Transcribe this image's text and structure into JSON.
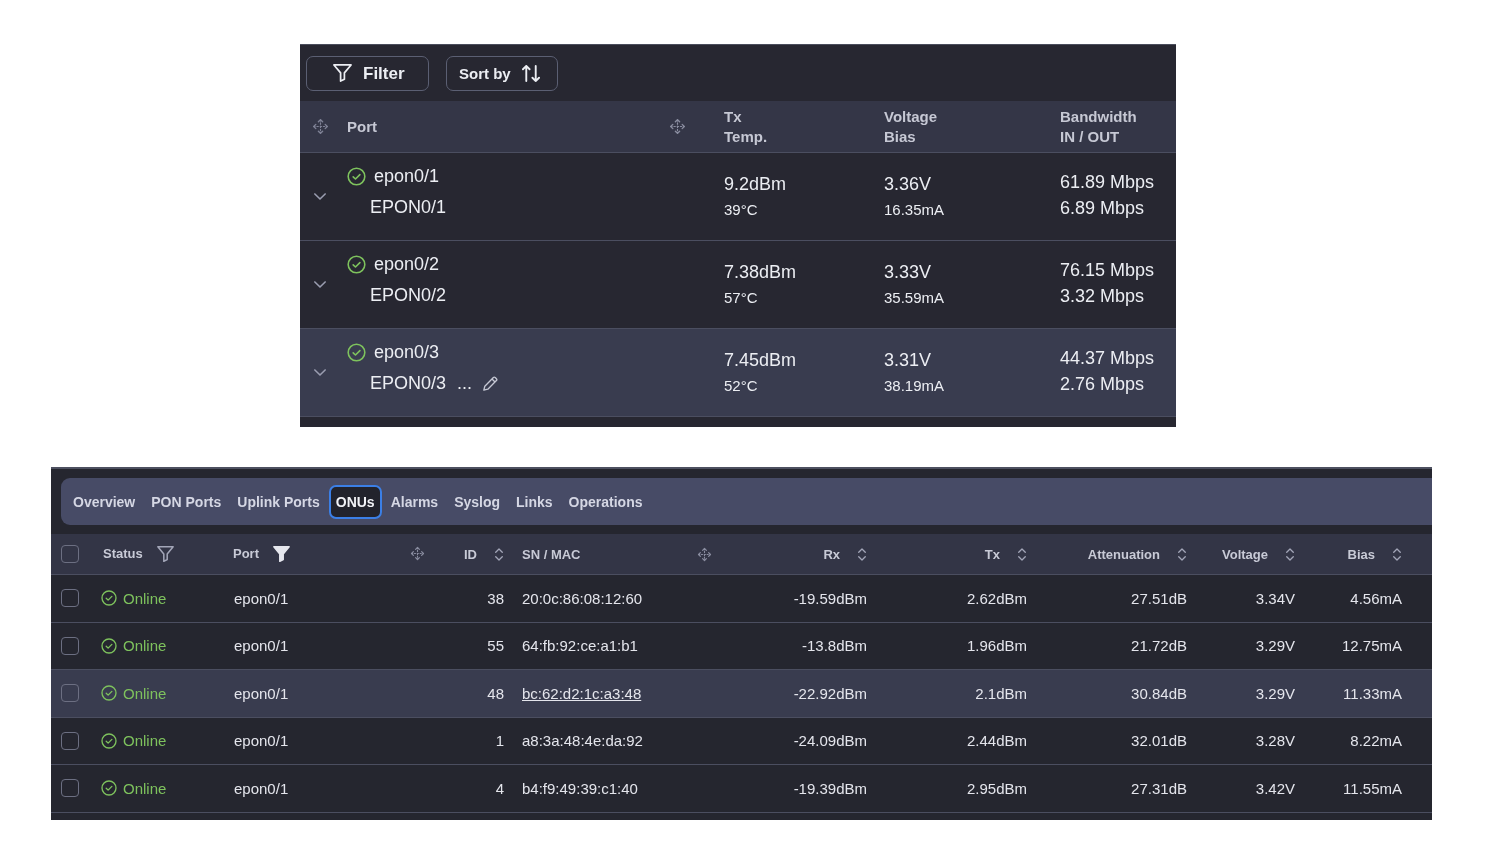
{
  "port_panel": {
    "toolbar": [
      {
        "kind": "filter",
        "label": "Filter"
      },
      {
        "kind": "sort",
        "label": "Sort by"
      }
    ],
    "columns": [
      {
        "kind": "port",
        "lines": [
          "Port"
        ],
        "movable": true
      },
      {
        "kind": "reading",
        "lines": [
          "Tx",
          "Temp."
        ],
        "movable": false
      },
      {
        "kind": "reading",
        "lines": [
          "Voltage",
          "Bias"
        ],
        "movable": false
      },
      {
        "kind": "rate",
        "lines": [
          "Bandwidth",
          "IN / OUT"
        ],
        "movable": false
      }
    ],
    "rows": [
      {
        "online": true,
        "expanded": false,
        "hovered": false,
        "cells": [
          [
            "epon0/1",
            "EPON0/1"
          ],
          [
            "9.2dBm",
            "39°C"
          ],
          [
            "3.36V",
            "16.35mA"
          ],
          [
            "61.89 Mbps",
            "6.89 Mbps"
          ]
        ]
      },
      {
        "online": true,
        "expanded": false,
        "hovered": false,
        "cells": [
          [
            "epon0/2",
            "EPON0/2"
          ],
          [
            "7.38dBm",
            "57°C"
          ],
          [
            "3.33V",
            "35.59mA"
          ],
          [
            "76.15 Mbps",
            "3.32 Mbps"
          ]
        ]
      },
      {
        "online": true,
        "expanded": false,
        "hovered": true,
        "edit_hint": "...",
        "cells": [
          [
            "epon0/3",
            "EPON0/3"
          ],
          [
            "7.45dBm",
            "52°C"
          ],
          [
            "3.31V",
            "38.19mA"
          ],
          [
            "44.37 Mbps",
            "2.76 Mbps"
          ]
        ]
      }
    ]
  },
  "device_panel": {
    "tabs": [
      {
        "label": "Overview",
        "selected": false
      },
      {
        "label": "PON Ports",
        "selected": false
      },
      {
        "label": "Uplink Ports",
        "selected": false
      },
      {
        "label": "ONUs",
        "selected": true
      },
      {
        "label": "Alarms",
        "selected": false
      },
      {
        "label": "Syslog",
        "selected": false
      },
      {
        "label": "Links",
        "selected": false
      },
      {
        "label": "Operations",
        "selected": false
      }
    ],
    "table": {
      "select_all_checked": false,
      "columns": [
        {
          "kind": "filter",
          "label": "Status",
          "filtered": false,
          "movable": false
        },
        {
          "kind": "filter",
          "label": "Port",
          "filtered": true,
          "movable": true
        },
        {
          "kind": "sort",
          "label": "ID",
          "movable": false
        },
        {
          "kind": "link",
          "label": "SN / MAC",
          "movable": true
        },
        {
          "kind": "sort",
          "label": "Rx",
          "movable": false
        },
        {
          "kind": "sort",
          "label": "Tx",
          "movable": false
        },
        {
          "kind": "sort",
          "label": "Attenuation",
          "movable": false
        },
        {
          "kind": "sort",
          "label": "Voltage",
          "movable": false
        },
        {
          "kind": "sort",
          "label": "Bias",
          "movable": false
        }
      ],
      "rows": [
        {
          "checked": false,
          "hovered": false,
          "online": true,
          "cells": [
            "Online",
            "epon0/1",
            "38",
            "20:0c:86:08:12:60",
            "-19.59dBm",
            "2.62dBm",
            "27.51dB",
            "3.34V",
            "4.56mA"
          ]
        },
        {
          "checked": false,
          "hovered": false,
          "online": true,
          "cells": [
            "Online",
            "epon0/1",
            "55",
            "64:fb:92:ce:a1:b1",
            "-13.8dBm",
            "1.96dBm",
            "21.72dB",
            "3.29V",
            "12.75mA"
          ]
        },
        {
          "checked": false,
          "hovered": true,
          "online": true,
          "cells": [
            "Online",
            "epon0/1",
            "48",
            "bc:62:d2:1c:a3:48",
            "-22.92dBm",
            "2.1dBm",
            "30.84dB",
            "3.29V",
            "11.33mA"
          ]
        },
        {
          "checked": false,
          "hovered": false,
          "online": true,
          "cells": [
            "Online",
            "epon0/1",
            "1",
            "a8:3a:48:4e:da:92",
            "-24.09dBm",
            "2.44dBm",
            "32.01dB",
            "3.28V",
            "8.22mA"
          ]
        },
        {
          "checked": false,
          "hovered": false,
          "online": true,
          "cells": [
            "Online",
            "epon0/1",
            "4",
            "b4:f9:49:39:c1:40",
            "-19.39dBm",
            "2.95dBm",
            "27.31dB",
            "3.42V",
            "11.55mA"
          ]
        }
      ]
    }
  }
}
